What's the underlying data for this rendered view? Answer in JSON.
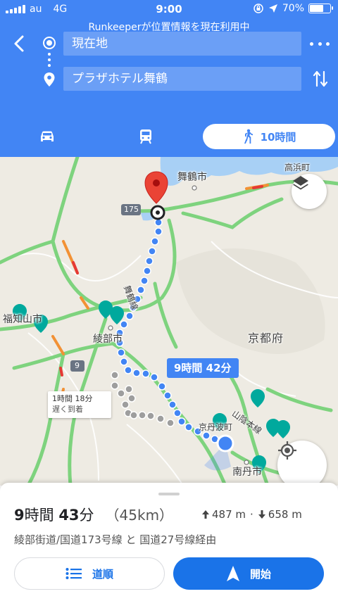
{
  "status_bar": {
    "carrier": "au",
    "network": "4G",
    "time": "9:00",
    "battery": "70%",
    "battery_level": 0.7
  },
  "banner": "Runkeeperが位置情報を現在利用中",
  "directions": {
    "origin": "現在地",
    "destination": "プラザホテル舞鶴"
  },
  "modes": {
    "walk_duration": "10時間",
    "selected": "walk"
  },
  "map": {
    "labels": {
      "maizuru": "舞鶴市",
      "takahama": "高浜町",
      "fukuchiyama": "福知山市",
      "ayabe": "綾部市",
      "kyoto_pref": "京都府",
      "kyotamba": "京丹波町",
      "nantan": "南丹市",
      "sanin": "山陰本線",
      "maizuru_line": "舞鶴線",
      "route_175": "175",
      "route_9": "9"
    },
    "route_chip": "9時間 42分",
    "alt_chip": {
      "time": "1時間 18分",
      "note": "遅く到着"
    },
    "colors": {
      "route": "#4285f4",
      "alt_route": "#9e9e9e",
      "road_green": "#7ed37e",
      "water": "#a8d0f5",
      "pin": "#ea4335"
    }
  },
  "summary": {
    "duration_h": "9",
    "duration_h_unit": "時間",
    "duration_m": "43",
    "duration_m_unit": "分",
    "distance": "（45km）",
    "ascent": "487 m",
    "separator": "·",
    "descent": "658 m",
    "via": "綾部街道/国道173号線 と 国道27号線経由"
  },
  "buttons": {
    "steps": "道順",
    "start": "開始"
  }
}
